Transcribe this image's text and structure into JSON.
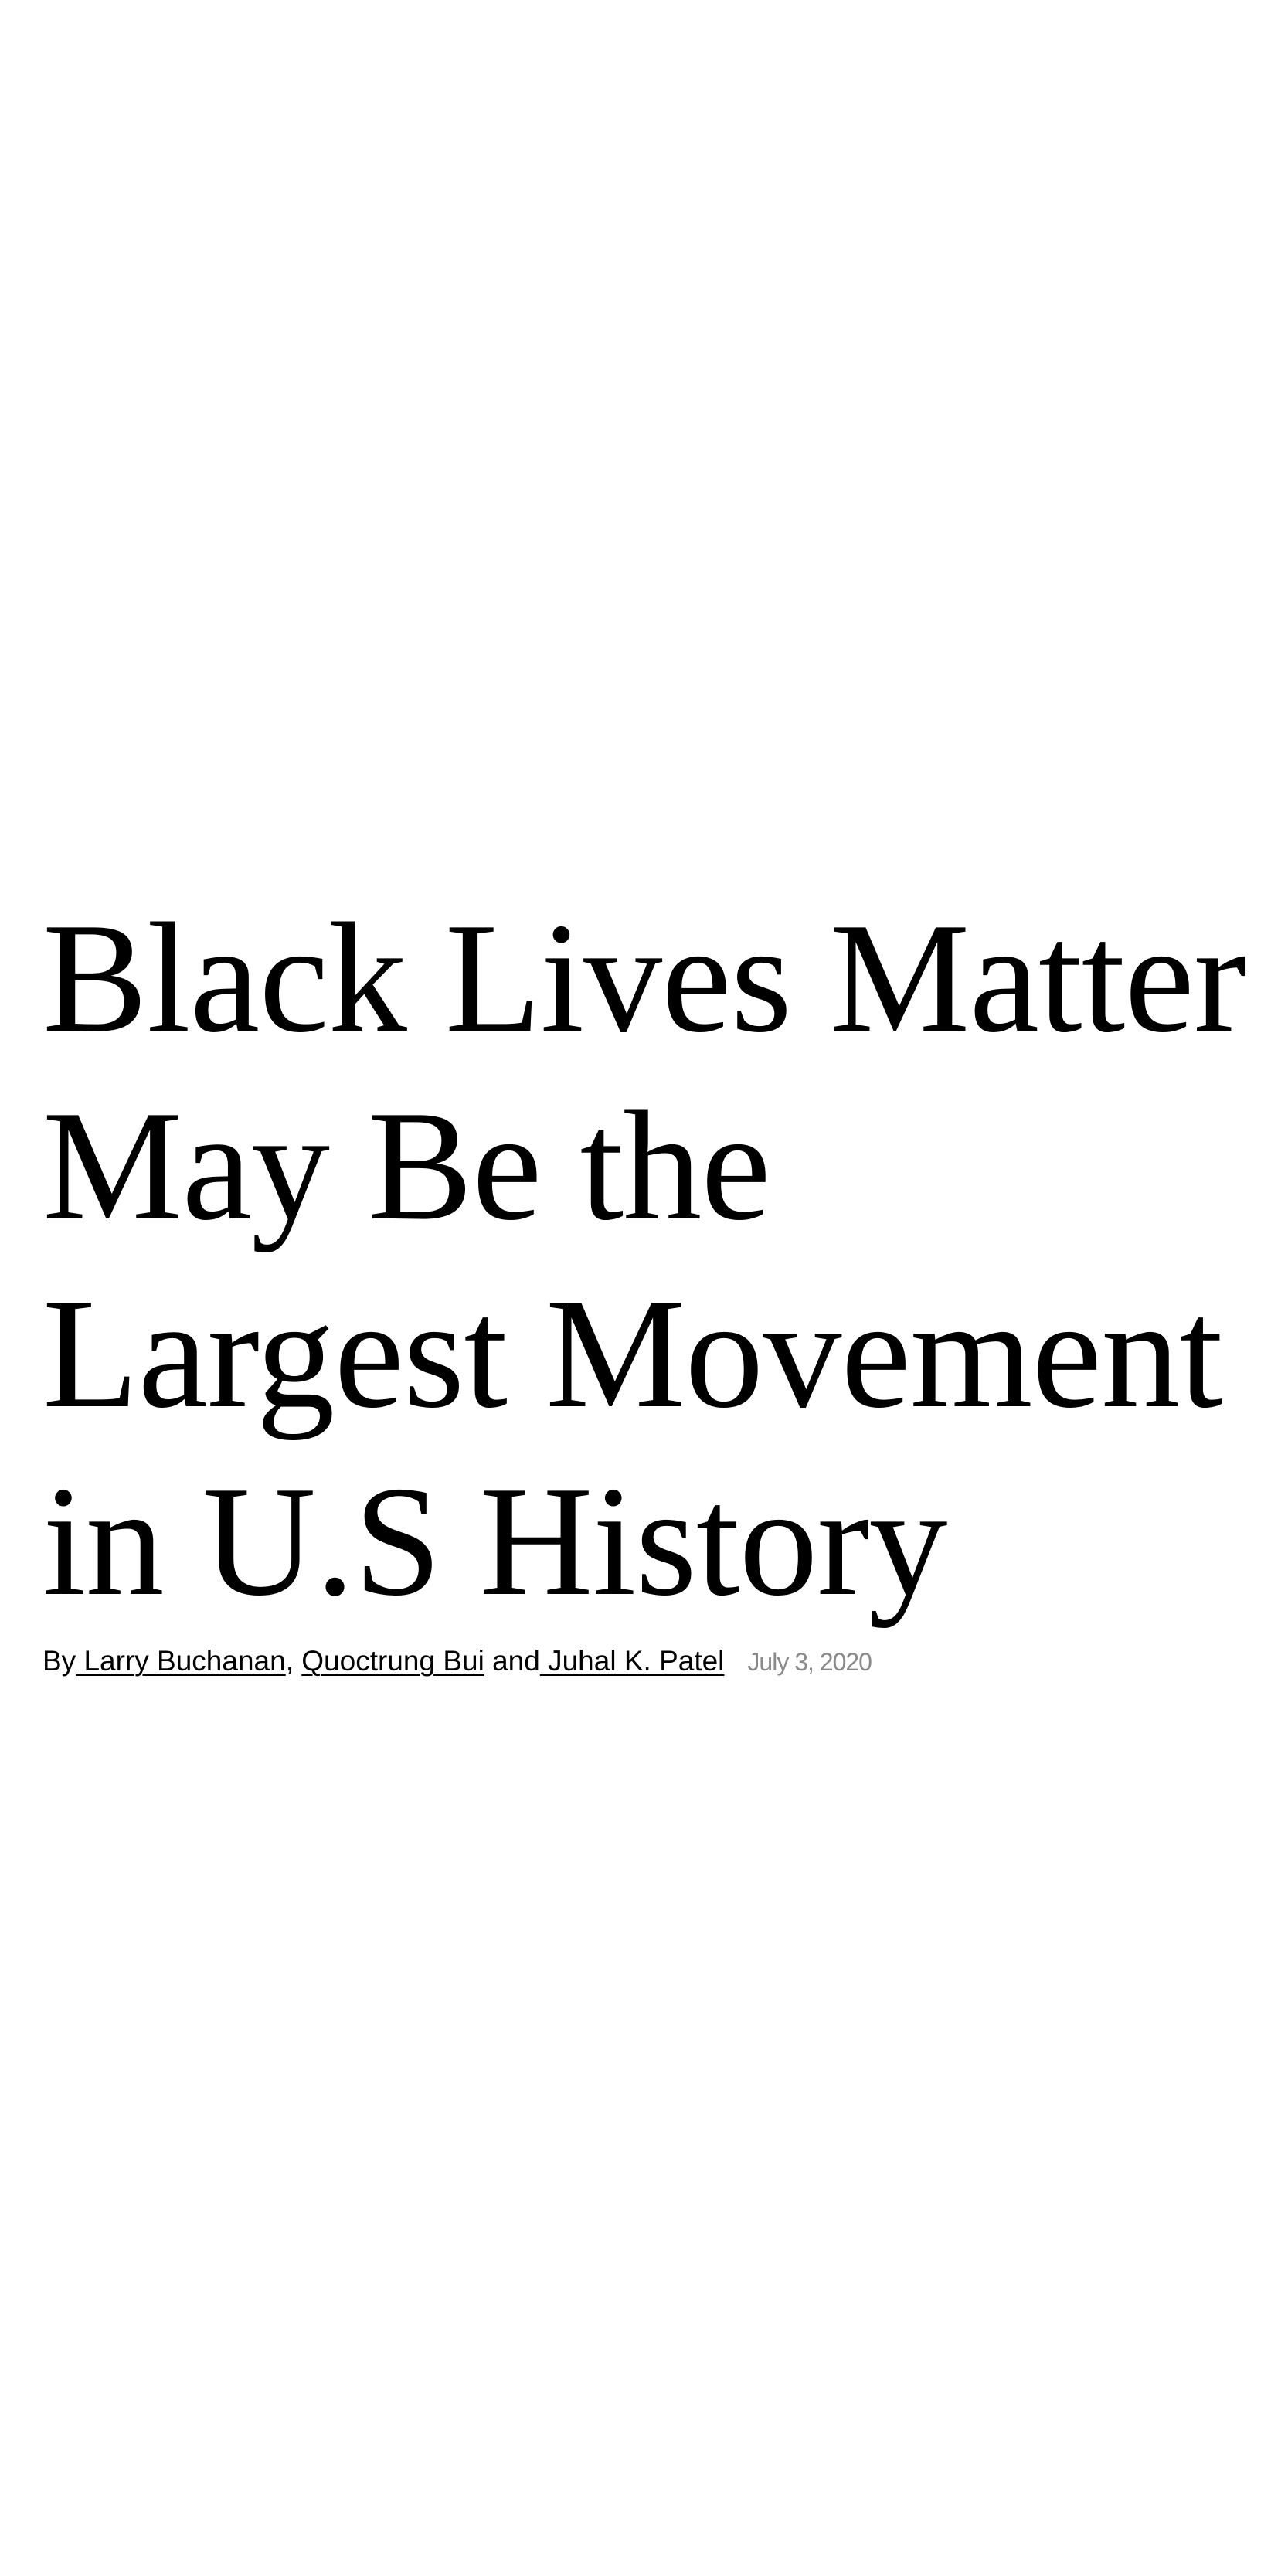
{
  "article": {
    "headline_lines": [
      "Black Lives Matter",
      "May Be the",
      "Largest Movement",
      "in U.S History"
    ],
    "byline": {
      "prefix": "By",
      "authors": [
        " Larry Buchanan",
        "Quoctrung Bui",
        " Juhal K. Patel"
      ],
      "separator_comma": ", ",
      "separator_and": " and",
      "date": "July 3, 2020"
    }
  }
}
